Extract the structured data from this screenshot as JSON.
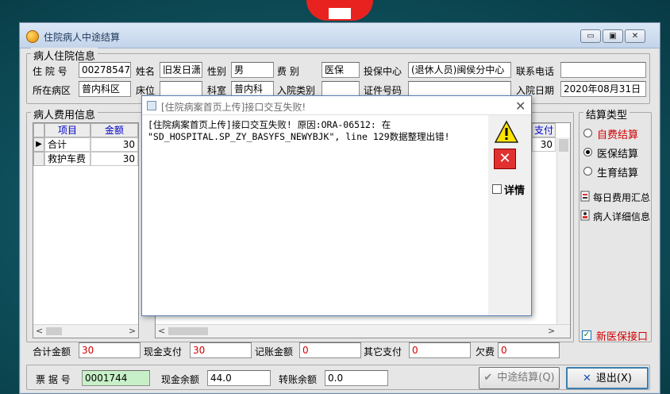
{
  "window": {
    "title": "住院病人中途结算",
    "buttons": {
      "minimize": "▭",
      "restore": "▣",
      "close": "✕"
    }
  },
  "patient_info": {
    "group_label": "病人住院信息",
    "inpatient_no": {
      "label": "住 院 号",
      "value": "00278547"
    },
    "name": {
      "label": "姓名",
      "value": "旧发日潇"
    },
    "sex": {
      "label": "性别",
      "value": "男"
    },
    "fee_type": {
      "label": "费    别",
      "value": "医保"
    },
    "insurance_center": {
      "label": "投保中心",
      "value": "(退休人员)闽侯分中心"
    },
    "phone": {
      "label": "联系电话",
      "value": ""
    },
    "ward": {
      "label": "所在病区",
      "value": "普内科区"
    },
    "bed": {
      "label": "床位",
      "value": ""
    },
    "department": {
      "label": "科室",
      "value": "普内科"
    },
    "admission_type": {
      "label": "入院类别",
      "value": ""
    },
    "id_no": {
      "label": "证件号码",
      "value": ""
    },
    "admission_date": {
      "label": "入院日期",
      "value": "2020年08月31日"
    }
  },
  "fee_info": {
    "group_label": "病人费用信息",
    "columns": [
      "项目",
      "金额"
    ],
    "rows": [
      {
        "item": "合计",
        "amount": "30"
      },
      {
        "item": "救护车费",
        "amount": "30"
      }
    ],
    "right_column_header": "支付",
    "right_column_value": "30"
  },
  "settlement_type": {
    "group_label": "结算类型",
    "options": [
      {
        "label": "自费结算",
        "checked": false,
        "color": "#d00000"
      },
      {
        "label": "医保结算",
        "checked": true,
        "color": "#000000"
      },
      {
        "label": "生育结算",
        "checked": false,
        "color": "#000000"
      }
    ],
    "links": [
      "每日费用汇总",
      "病人详细信息"
    ],
    "new_insurance": {
      "label": "新医保接口",
      "checked": true
    }
  },
  "totals": {
    "total_amount": {
      "label": "合计金额",
      "value": "30"
    },
    "cash_paid": {
      "label": "现金支付",
      "value": "30"
    },
    "account_amount": {
      "label": "记账金额",
      "value": "0"
    },
    "other_paid": {
      "label": "其它支付",
      "value": "0"
    },
    "owed": {
      "label": "欠费",
      "value": "0"
    }
  },
  "footer": {
    "receipt_no": {
      "label": "票 据 号",
      "value": "0001744"
    },
    "cash_balance": {
      "label": "现金余额",
      "value": "44.0"
    },
    "transfer_balance": {
      "label": "转账余额",
      "value": "0.0"
    },
    "settle_button": "中途结算(Q)",
    "exit_button": "退出(X)"
  },
  "dialog": {
    "title": "[住院病案首页上传]接口交互失败!",
    "message_line1": "[住院病案首页上传]接口交互失败! 原因:ORA-06512: 在",
    "message_line2": "\"SD_HOSPITAL.SP_ZY_BASYFS_NEWYBJK\", line 129数据整理出错!",
    "detail_label": "详情"
  }
}
